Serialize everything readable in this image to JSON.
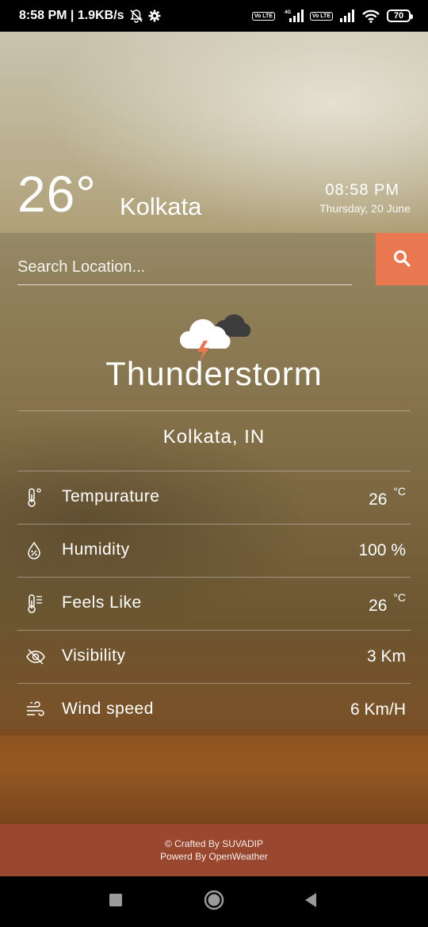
{
  "status_bar": {
    "time_speed": "8:58 PM | 1.9KB/s",
    "volte_1": "Vo LTE",
    "network_type": "4G",
    "volte_2": "Vo LTE",
    "battery": "70"
  },
  "header": {
    "temperature": "26°",
    "city": "Kolkata",
    "time": "08:58  PM",
    "date": "Thursday, 20 June"
  },
  "search": {
    "placeholder": "Search Location..."
  },
  "weather": {
    "condition": "Thunderstorm",
    "location": "Kolkata,  IN",
    "icon": "thunderstorm-cloud-icon"
  },
  "stats": [
    {
      "label": "Tempurature",
      "value": "26",
      "unit": "°C",
      "icon": "thermometer-icon"
    },
    {
      "label": "Humidity",
      "value": "100 %",
      "unit": "",
      "icon": "humidity-drop-icon"
    },
    {
      "label": "Feels Like",
      "value": "26",
      "unit": "°C",
      "icon": "feels-like-thermometer-icon"
    },
    {
      "label": "Visibility",
      "value": "3 Km",
      "unit": "",
      "icon": "eye-slash-icon"
    },
    {
      "label": "Wind speed",
      "value": "6 Km/H",
      "unit": "",
      "icon": "wind-icon"
    }
  ],
  "footer": {
    "credit": "© Crafted By SUVADIP",
    "powered": "Powerd By OpenWeather"
  },
  "colors": {
    "accent": "#e9774f",
    "footer": "#9a472f",
    "lightning": "#e9774f"
  }
}
